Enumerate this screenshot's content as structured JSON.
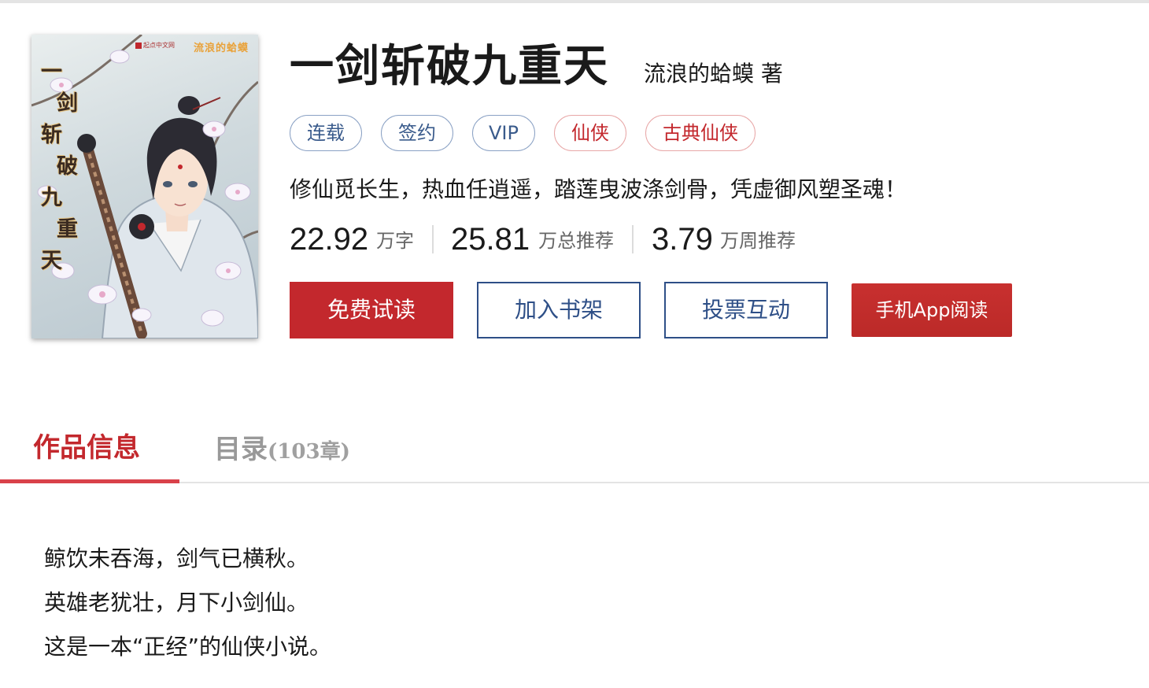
{
  "book": {
    "title": "一剑斩破九重天",
    "author": "流浪的蛤蟆 著",
    "cover": {
      "vertical_title": [
        "一",
        "剑",
        "斩",
        "破",
        "九",
        "重",
        "天"
      ],
      "author_text": "流浪的蛤蟆",
      "logo_text": "起点中文网"
    },
    "tags": [
      {
        "label": "连载",
        "style": "blue"
      },
      {
        "label": "签约",
        "style": "blue"
      },
      {
        "label": "VIP",
        "style": "blue"
      },
      {
        "label": "仙侠",
        "style": "red"
      },
      {
        "label": "古典仙侠",
        "style": "red"
      }
    ],
    "intro": "修仙觅长生，热血任逍遥，踏莲曳波涤剑骨，凭虚御风塑圣魂！",
    "stats": [
      {
        "value": "22.92",
        "unit": "万字"
      },
      {
        "value": "25.81",
        "unit": "万总推荐"
      },
      {
        "value": "3.79",
        "unit": "万周推荐"
      }
    ]
  },
  "actions": {
    "free_read": "免费试读",
    "add_shelf": "加入书架",
    "vote": "投票互动",
    "mobile_app": "手机App阅读"
  },
  "tabs": {
    "info": "作品信息",
    "toc": "目录",
    "toc_count": "(103章)"
  },
  "description": [
    "鲸饮未吞海，剑气已横秋。",
    "英雄老犹壮，月下小剑仙。",
    "这是一本“正经”的仙侠小说。"
  ],
  "colors": {
    "accent_red": "#c3282d",
    "tag_blue": "#3a5b8c",
    "outline_blue": "#2e4f87",
    "tab_underline": "#d9414a"
  }
}
